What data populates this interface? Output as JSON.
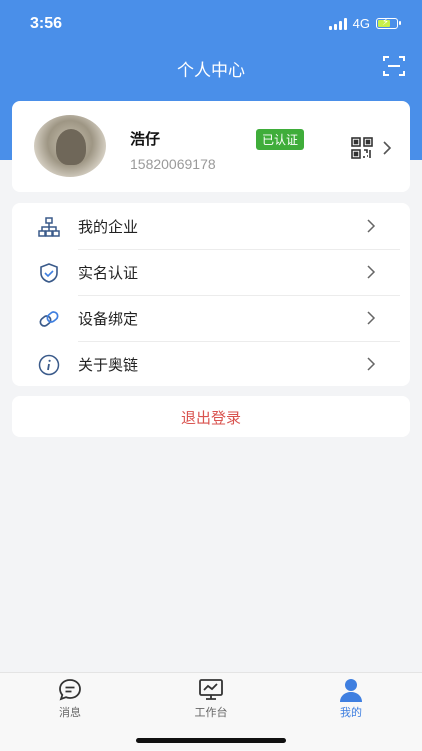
{
  "status_bar": {
    "time": "3:56",
    "network": "4G",
    "battery_color": "#c8f04a"
  },
  "header": {
    "title": "个人中心",
    "scan_icon": "scan-icon",
    "background": "#4a8fe9"
  },
  "profile": {
    "name": "浩仔",
    "phone": "15820069178",
    "badge": "已认证",
    "badge_color": "#3fad3a",
    "qr_icon": "qr-code-icon"
  },
  "menu": {
    "items": [
      {
        "label": "我的企业",
        "icon": "org-chart-icon"
      },
      {
        "label": "实名认证",
        "icon": "shield-check-icon"
      },
      {
        "label": "设备绑定",
        "icon": "link-icon"
      },
      {
        "label": "关于奥链",
        "icon": "info-icon"
      }
    ]
  },
  "logout": {
    "label": "退出登录",
    "color": "#d9534f"
  },
  "tabbar": {
    "tabs": [
      {
        "label": "消息",
        "icon": "message-icon"
      },
      {
        "label": "工作台",
        "icon": "workbench-icon"
      },
      {
        "label": "我的",
        "icon": "user-icon",
        "active": true
      }
    ],
    "active_color": "#3f7fe0"
  }
}
